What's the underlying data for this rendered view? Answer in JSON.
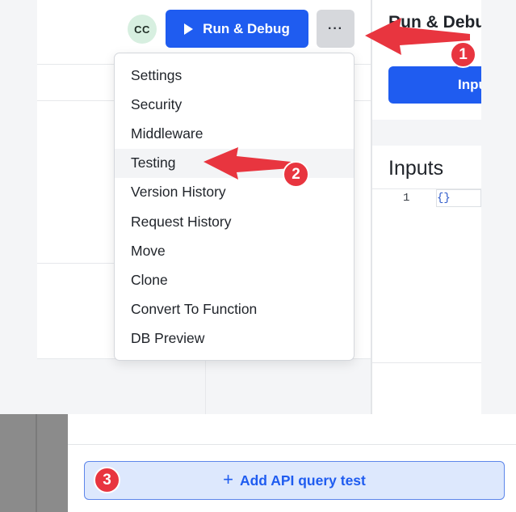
{
  "header": {
    "avatar_initials": "CC",
    "run_debug_label": "Run & Debug",
    "more_label": "···"
  },
  "right_panel": {
    "title": "Run & Debu",
    "inputs_button_label": "Inpu",
    "inputs_label": "Inputs",
    "code_line_number": "1",
    "code_line_text": "{}"
  },
  "menu": {
    "items": [
      {
        "label": "Settings"
      },
      {
        "label": "Security"
      },
      {
        "label": "Middleware"
      },
      {
        "label": "Testing"
      },
      {
        "label": "Version History"
      },
      {
        "label": "Request History"
      },
      {
        "label": "Move"
      },
      {
        "label": "Clone"
      },
      {
        "label": "Convert To Function"
      },
      {
        "label": "DB Preview"
      }
    ],
    "highlighted_item": "Testing"
  },
  "annotations": {
    "badge_1": "1",
    "badge_2": "2",
    "badge_3": "3",
    "color": "#e8353f"
  },
  "testing": {
    "add_test_label": "Add API query test",
    "add_icon": "+"
  },
  "colors": {
    "primary": "#1f5cf0",
    "add_button_bg": "#dde8fd",
    "annotation_red": "#e8353f"
  }
}
